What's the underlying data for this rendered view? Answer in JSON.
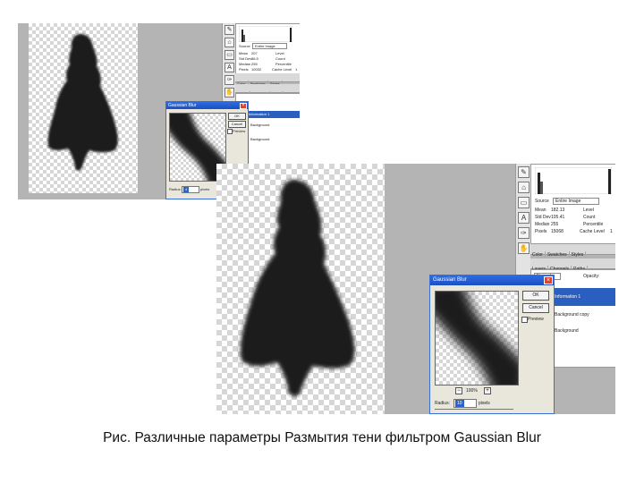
{
  "caption": "Рис. Различные параметры Размытия тени фильтром Gaussian Blur",
  "screenshot_small": {
    "histogram": {
      "source_label": "Source",
      "source_value": "Entire Image",
      "stats": {
        "mean_label": "Mean",
        "mean": "207",
        "level_label": "Level",
        "std_dev_label": "Std Dev",
        "std_dev": "86.5",
        "count_label": "Count",
        "median_label": "Median",
        "median": "255",
        "percentile_label": "Percentile",
        "pixels_label": "Pixels",
        "pixels": "10032",
        "cache_level_label": "Cache Level",
        "cache_level": "1"
      }
    },
    "layer_tabs": [
      "Color",
      "Swatches",
      "Styles"
    ],
    "panel_tabs": [
      "Layers",
      "Channels",
      "Paths"
    ],
    "dialog": {
      "title": "Gaussian Blur",
      "ok": "OK",
      "cancel": "Cancel",
      "preview_label": "Preview",
      "radius_label": "Radius:",
      "radius_value": "4",
      "radius_unit": "pixels"
    },
    "side_band": {
      "selected": "Information 1",
      "item2": "Background",
      "item3": "Background"
    }
  },
  "screenshot_large": {
    "histogram": {
      "source_label": "Source",
      "source_value": "Entire Image",
      "stats": {
        "mean_label": "Mean",
        "mean": "182.13",
        "level_label": "Level",
        "std_dev_label": "Std Dev",
        "std_dev": "105.41",
        "count_label": "Count",
        "median_label": "Median",
        "median": "255",
        "percentile_label": "Percentile",
        "pixels_label": "Pixels",
        "pixels": "15068",
        "cache_level_label": "Cache Level",
        "cache_level": "1"
      }
    },
    "layer_tabs": [
      "Color",
      "Swatches",
      "Styles"
    ],
    "panel_tabs": [
      "Layers",
      "Channels",
      "Paths"
    ],
    "blend_mode": "Normal",
    "opacity_label": "Opacity:",
    "dialog": {
      "title": "Gaussian Blur",
      "ok": "OK",
      "cancel": "Cancel",
      "preview_label": "Preview",
      "zoom": "100%",
      "radius_label": "Radius:",
      "radius_value": "10",
      "radius_unit": "pixels"
    },
    "side_band": {
      "selected": "Information 1",
      "item2": "Background copy",
      "item3": "Background"
    }
  },
  "colors": {
    "dialog_title": "#2d6ce0",
    "selection": "#2a5fbf",
    "silhouette": "#1c1c1e",
    "close": "#d8442e"
  }
}
